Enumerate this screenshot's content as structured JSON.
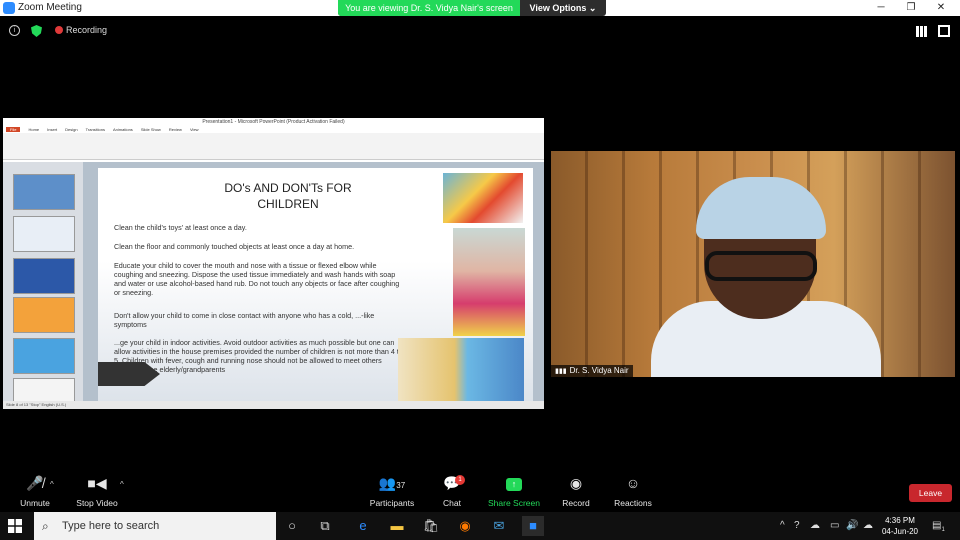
{
  "window": {
    "title": "Zoom Meeting",
    "minimize": "─",
    "maximize": "❐",
    "close": "✕"
  },
  "banner": {
    "viewing": "You are viewing Dr. S. Vidya Nair's screen",
    "view_options": "View Options ⌄"
  },
  "topbar": {
    "recording": "Recording",
    "info_icon": "info-icon",
    "shield_icon": "shield-icon"
  },
  "presentation": {
    "window_title": "Presentation1 - Microsoft PowerPoint (Product Activation Failed)",
    "tabs": [
      "File",
      "Home",
      "Insert",
      "Design",
      "Transitions",
      "Animations",
      "Slide Show",
      "Review",
      "View"
    ],
    "slide_title_line1": "DO's AND DON'Ts FOR",
    "slide_title_line2": "CHILDREN",
    "bullets": [
      "Clean the child's toys' at least once a day.",
      "Clean the floor and commonly touched objects at least once a day at home.",
      "Educate your child to cover the mouth and nose with a tissue or flexed elbow while coughing and sneezing. Dispose the used tissue immediately and wash hands with soap and water or use alcohol-based hand rub. Do not touch any objects or face after coughing or sneezing.",
      "Don't allow your child to come in close contact with anyone who has a cold, ...-like symptoms",
      "...ge your child in indoor activities. Avoid outdoor activities as much possible but one can allow activities in the house premises provided the number of children is not more than 4 to 5. Children with fever, cough and running nose should not be allowed to meet others especially the elderly/grandparents"
    ],
    "status": "Slide 8 of 13   \"Stop\"   English (U.S.)"
  },
  "video": {
    "name": "Dr. S. Vidya Nair"
  },
  "toolbar": {
    "unmute": "Unmute",
    "stop_video": "Stop Video",
    "participants": "Participants",
    "participants_count": "37",
    "chat": "Chat",
    "chat_badge": "1",
    "share_screen": "Share Screen",
    "record": "Record",
    "reactions": "Reactions",
    "leave": "Leave"
  },
  "taskbar": {
    "search_placeholder": "Type here to search",
    "time": "4:36 PM",
    "date": "04-Jun-20",
    "notifications": "1"
  },
  "colors": {
    "zoom_blue": "#2d8cff",
    "banner_green": "#23d959",
    "leave_red": "#c8272d"
  }
}
